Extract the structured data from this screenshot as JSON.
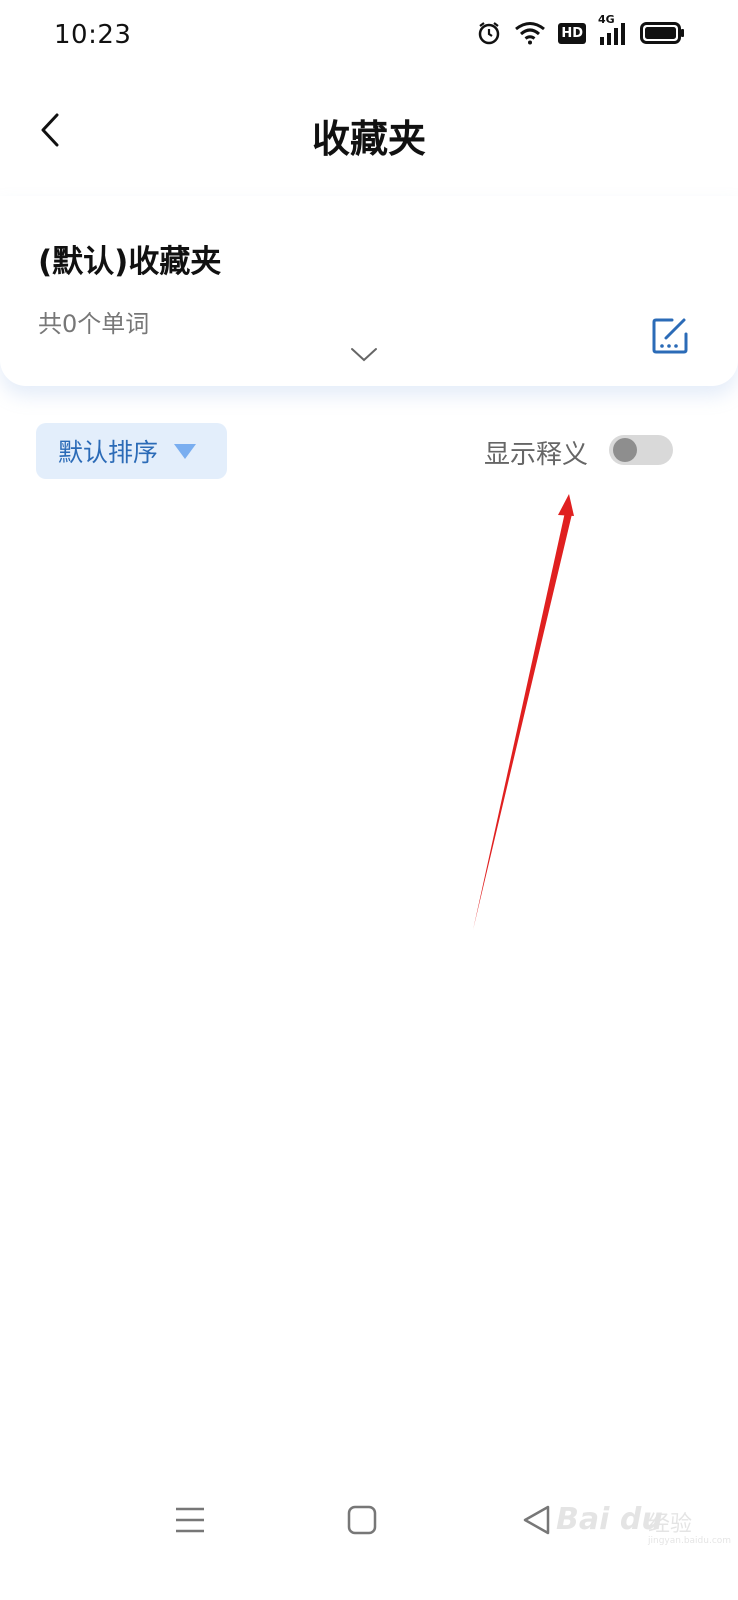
{
  "status_bar": {
    "time": "10:23",
    "icons": [
      "alarm-icon",
      "wifi-icon",
      "hd-icon",
      "signal-4g-icon",
      "battery-icon"
    ],
    "hd_label": "HD",
    "network_label": "4G"
  },
  "header": {
    "title": "收藏夹",
    "back_icon": "chevron-left-icon"
  },
  "folder": {
    "name": "(默认)收藏夹",
    "count_text": "共0个单词",
    "edit_icon": "edit-icon",
    "expand_icon": "chevron-down-icon"
  },
  "toolbar": {
    "sort_label": "默认排序",
    "show_definition_label": "显示释义",
    "show_definition_on": false
  },
  "colors": {
    "accent": "#2b6bb7",
    "sort_bg": "#e3eefb",
    "annotation_arrow": "#e02020"
  },
  "nav_bar": {
    "icons": [
      "menu-icon",
      "home-square-icon",
      "back-triangle-icon"
    ]
  },
  "watermark": {
    "brand": "Bai du",
    "text": "经验",
    "url": "jingyan.baidu.com"
  }
}
